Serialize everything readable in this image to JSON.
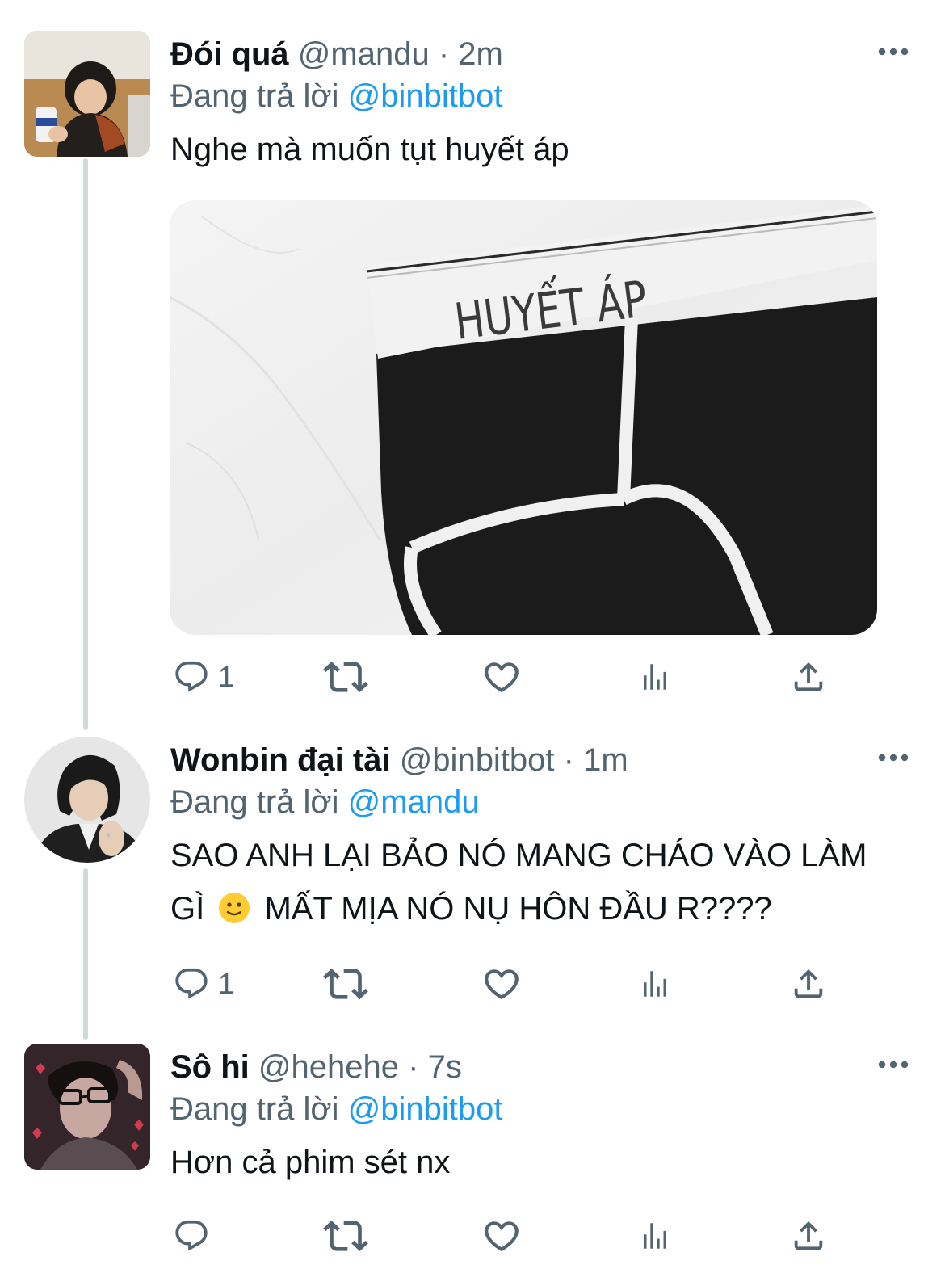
{
  "colors": {
    "accent": "#1d9bf0",
    "secondary_text": "#536471",
    "thread_line": "#cfd9de"
  },
  "tweets": [
    {
      "avatar_icon": "child-photo-avatar",
      "name": "Đói quá",
      "handle": "@mandu",
      "separator": "·",
      "time": "2m",
      "reply_prefix": "Đang trả lời",
      "reply_mention": "@binbitbot",
      "text": "Nghe mà muốn tụt huyết áp",
      "media": {
        "caption_text": "HUYẾT ÁP"
      },
      "actions": {
        "reply_count": "1",
        "retweet_count": "",
        "like_count": "",
        "views_count": ""
      }
    },
    {
      "avatar_icon": "person-portrait-avatar",
      "name": "Wonbin đại tài",
      "handle": "@binbitbot",
      "separator": "·",
      "time": "1m",
      "reply_prefix": "Đang trả lời",
      "reply_mention": "@mandu",
      "text_line1": "SAO ANH LẠI BẢO NÓ MANG CHÁO VÀO LÀM",
      "text_line2_a": "GÌ",
      "text_line2_b": "MẤT MỊA NÓ NỤ HÔN ĐẦU R????",
      "emoji": "slightly-smiling-face-emoji",
      "actions": {
        "reply_count": "1",
        "retweet_count": "",
        "like_count": "",
        "views_count": ""
      }
    },
    {
      "avatar_icon": "glasses-person-avatar",
      "name": "Sô hi",
      "handle": "@hehehe",
      "separator": "·",
      "time": "7s",
      "reply_prefix": "Đang trả lời",
      "reply_mention": "@binbitbot",
      "text": "Hơn cả phim sét nx",
      "actions": {
        "reply_count": "",
        "retweet_count": "",
        "like_count": "",
        "views_count": ""
      }
    }
  ]
}
